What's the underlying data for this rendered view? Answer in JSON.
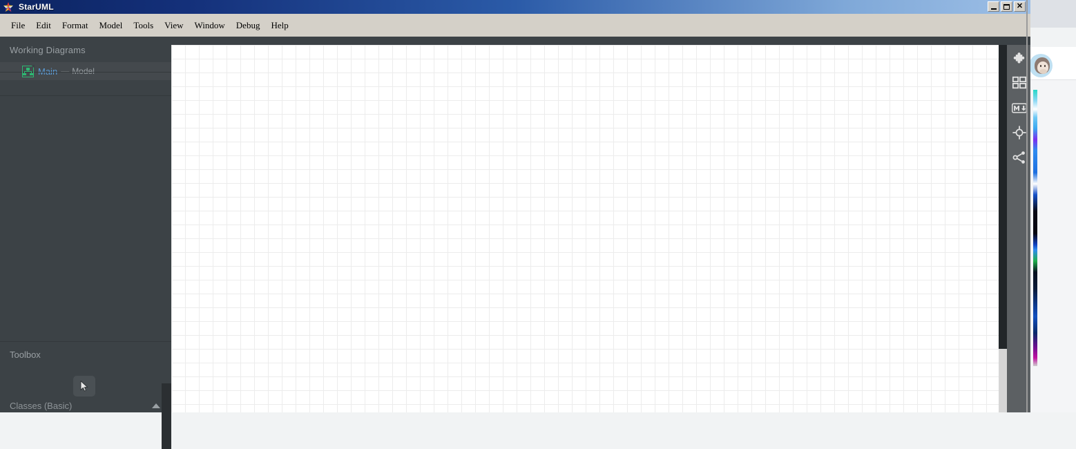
{
  "window": {
    "app_title": "StarUML",
    "logo_icon": "star-icon",
    "controls": [
      {
        "name": "minimize",
        "glyph": "_"
      },
      {
        "name": "maximize",
        "glyph": "□"
      },
      {
        "name": "close",
        "glyph": "×"
      }
    ]
  },
  "menubar": {
    "items": [
      {
        "label": "File"
      },
      {
        "label": "Edit"
      },
      {
        "label": "Format"
      },
      {
        "label": "Model"
      },
      {
        "label": "Tools"
      },
      {
        "label": "View"
      },
      {
        "label": "Window"
      },
      {
        "label": "Debug"
      },
      {
        "label": "Help"
      }
    ]
  },
  "sidebar": {
    "working_diagrams": {
      "header": "Working Diagrams",
      "items": [
        {
          "icon": "diagram-document-icon",
          "name": "Main",
          "separator": "—",
          "type": "Model",
          "selected": true
        }
      ]
    },
    "toolbox": {
      "header": "Toolbox",
      "tools": [
        {
          "icon": "select-cursor-icon",
          "label": "Select",
          "active": true
        }
      ],
      "groups": [
        {
          "label": "Classes (Basic)",
          "expanded": true,
          "caret": "chevron-up-icon"
        }
      ]
    }
  },
  "canvas": {
    "grid_enabled": true,
    "grid_size_px": 20,
    "background_color": "#ffffff",
    "grid_color": "#ececec"
  },
  "right_toolbar": {
    "icons": [
      {
        "name": "extension-puzzle-icon",
        "label": "Extension Manager"
      },
      {
        "name": "panels-grid-icon",
        "label": "Panels"
      },
      {
        "name": "markdown-icon",
        "label": "Markdown"
      },
      {
        "name": "target-crosshair-icon",
        "label": "Locate"
      },
      {
        "name": "share-network-icon",
        "label": "Share"
      }
    ]
  },
  "background_browser": {
    "new_tab_button": "+",
    "avatar": "monkey-avatar-icon"
  },
  "colors": {
    "titlebar_gradient_start": "#0c2461",
    "titlebar_gradient_end": "#9dbfe6",
    "menubar_bg": "#d4d0c8",
    "sidebar_bg": "#3c4246",
    "sidebar_selected_bg": "#44494d",
    "accent_link": "#5b9bd5",
    "diagram_icon_green": "#2eb872",
    "muted_text": "#9aa0a4",
    "right_toolbar_bg": "#5c6063"
  }
}
